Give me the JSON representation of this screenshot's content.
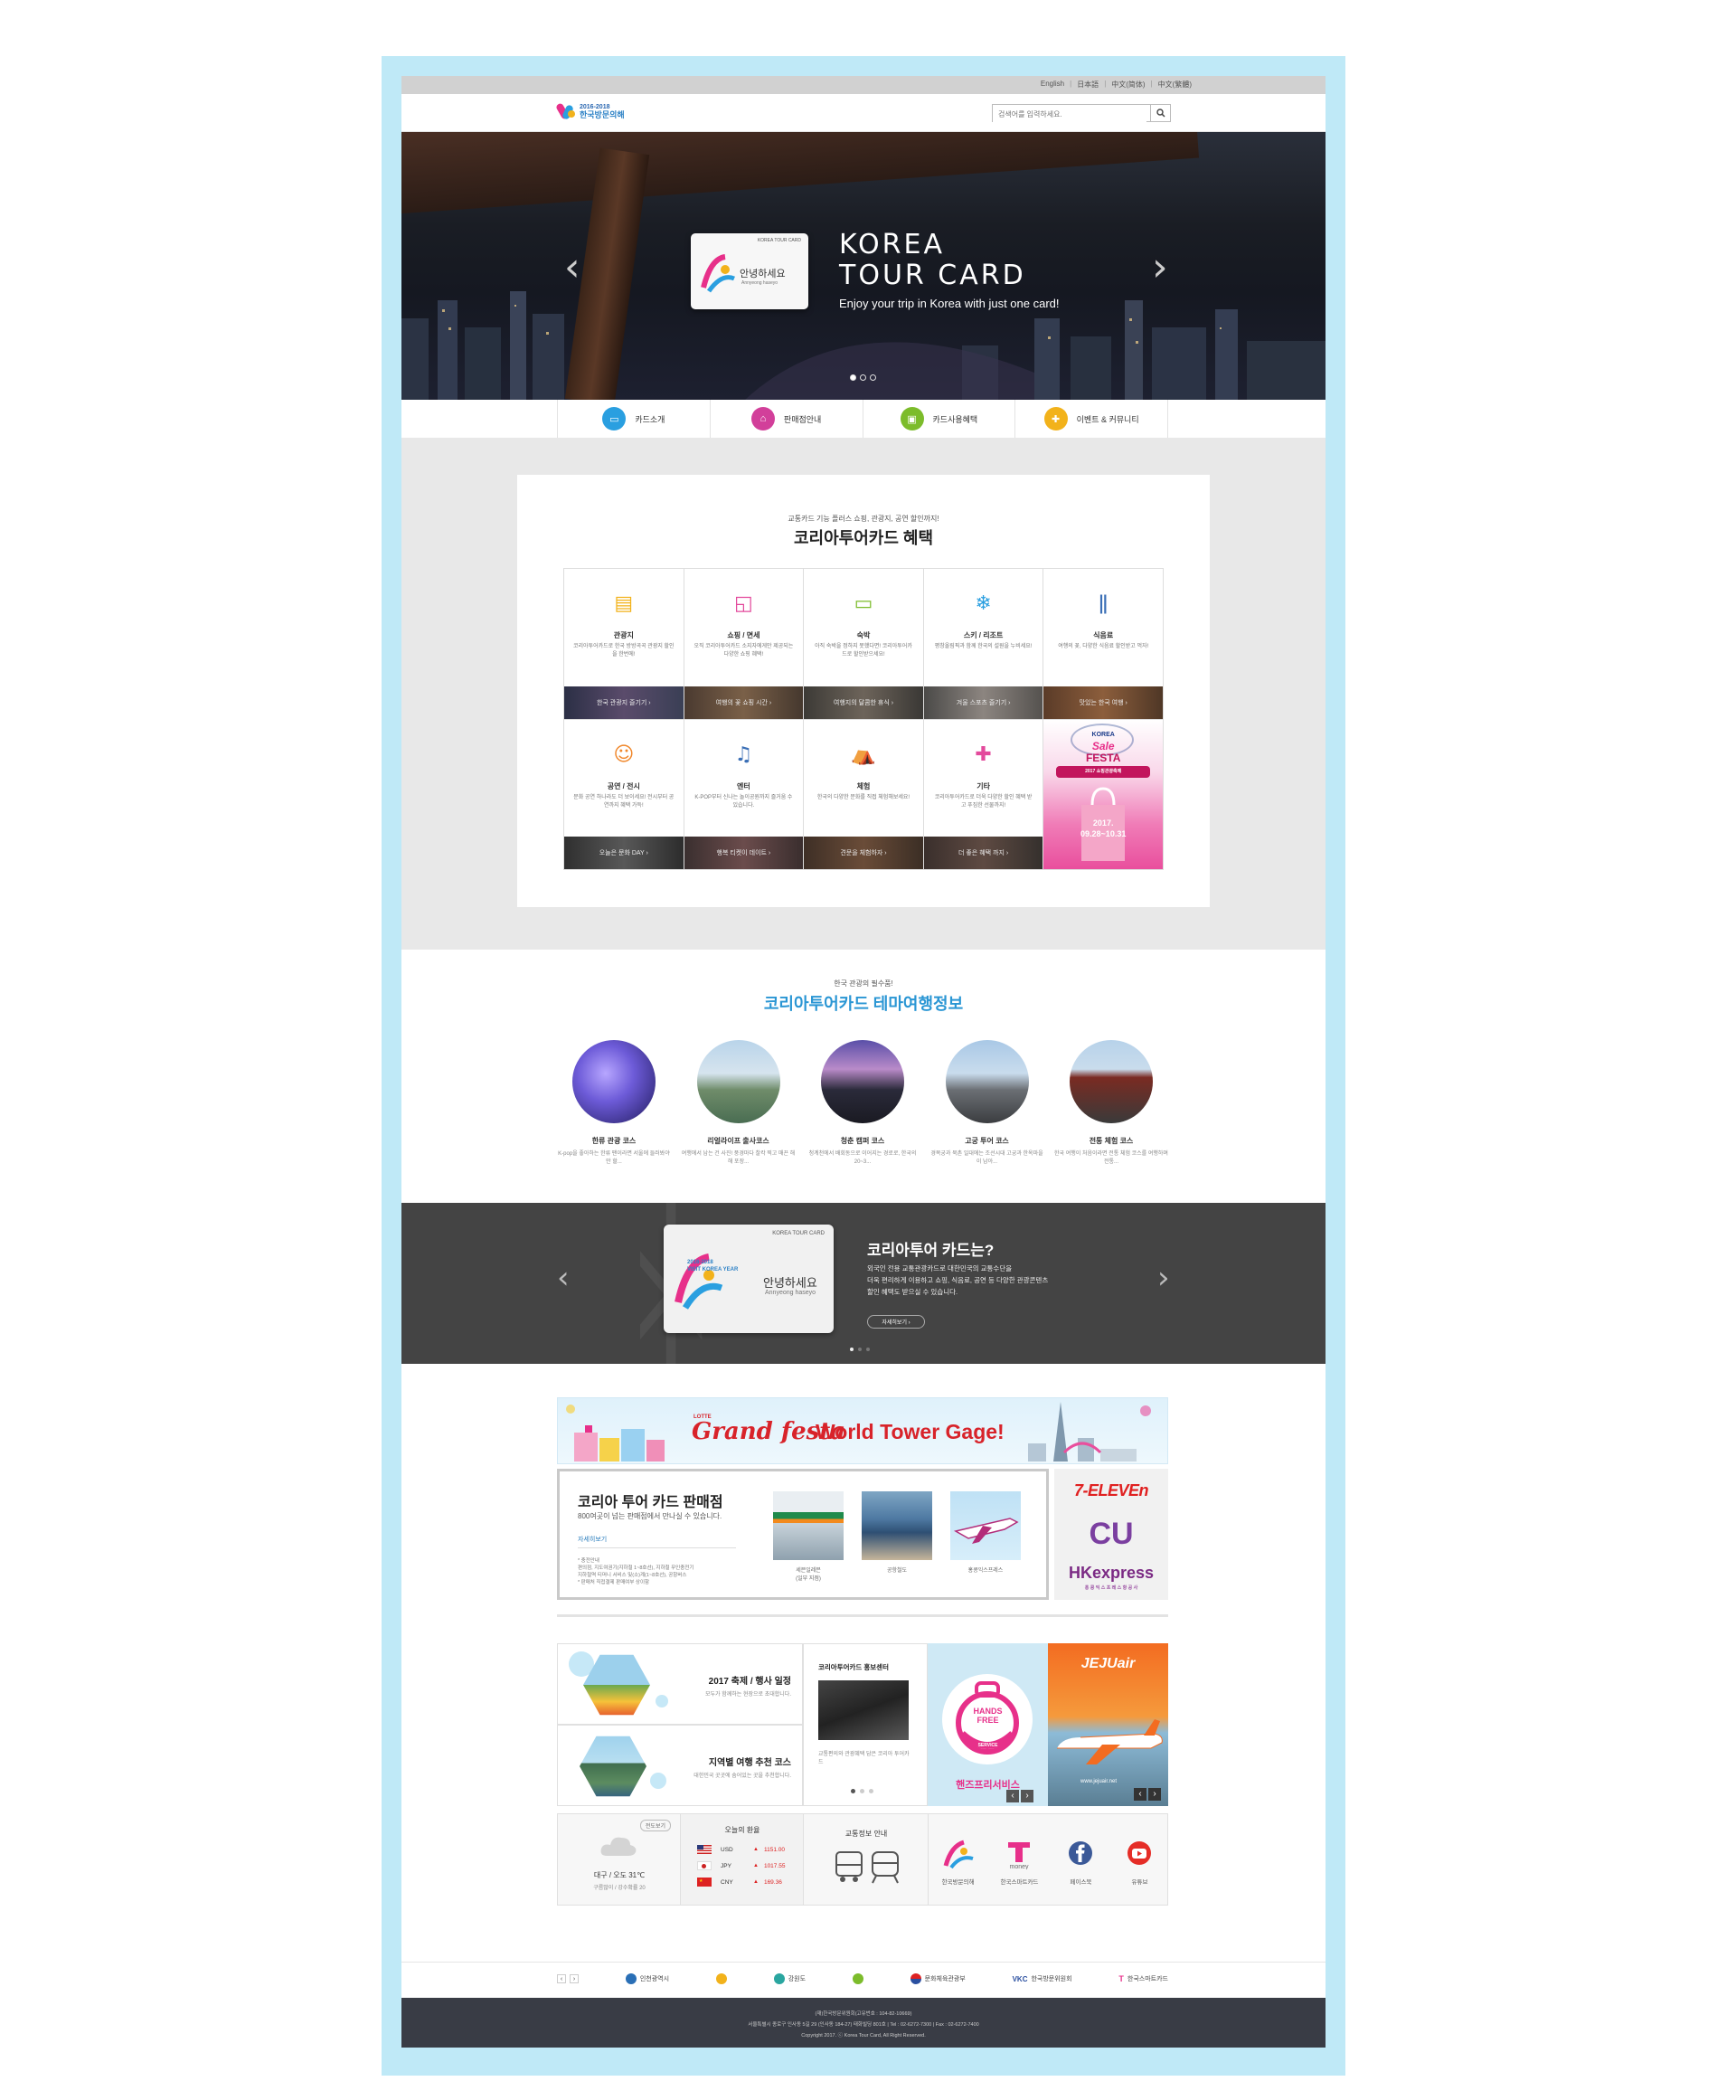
{
  "langbar": {
    "items": [
      "English",
      "日本語",
      "中文(简体)",
      "中文(繁體)"
    ]
  },
  "header": {
    "logo_years": "2016-2018",
    "logo_name": "한국방문의해",
    "search_placeholder": "검색어를 입력하세요."
  },
  "hero": {
    "card_title": "KOREA TOUR CARD",
    "card_greeting": "안녕하세요",
    "card_sub": "Annyeong haseyo",
    "title_line1": "KOREA",
    "title_line2": "TOUR CARD",
    "subtitle": "Enjoy your trip in Korea with just one card!",
    "prev_arrow": "‹",
    "next_arrow": "›",
    "slides": 3,
    "active_slide": 1
  },
  "quick_menu": [
    {
      "label": "카드소개",
      "icon": "card-icon",
      "color": "#2a9fe0",
      "glyph": "▭"
    },
    {
      "label": "판매점안내",
      "icon": "store-icon",
      "color": "#d23f9a",
      "glyph": "⌂"
    },
    {
      "label": "카드사용혜택",
      "icon": "wallet-icon",
      "color": "#7cbc2b",
      "glyph": "▣"
    },
    {
      "label": "이벤트 & 커뮤니티",
      "icon": "gift-icon",
      "color": "#f2b21b",
      "glyph": "✚"
    }
  ],
  "benefits": {
    "pre": "교통카드 기능 플러스 쇼핑, 관광지, 공연 할인까지!",
    "title": "코리아투어카드 혜택",
    "cells": [
      {
        "name": "관광지",
        "desc": "코리아투어카드로 한국 방방곡곡 관광지 할인을 한번에!",
        "strip": "한국 관광지 즐기기 ›",
        "icon": "ticket-icon",
        "glyph": "▤",
        "color": "#f2b21b"
      },
      {
        "name": "쇼핑 / 면세",
        "desc": "오직 코리아투어카드 소지자에게만 제공되는 다양한 쇼핑 혜택!",
        "strip": "여행의 꽃 쇼핑 시간 ›",
        "icon": "shopping-bag-icon",
        "glyph": "◱",
        "color": "#e34a9c"
      },
      {
        "name": "숙박",
        "desc": "아직 숙박을 정하지 못했다면! 코리아투어카드로 할인받으세요!",
        "strip": "여행지의 달콤한 휴식 ›",
        "icon": "bed-icon",
        "glyph": "▭",
        "color": "#7cbc2b"
      },
      {
        "name": "스키 / 리조트",
        "desc": "평창올림픽과 함께 한국의 설원을 누비세요!",
        "strip": "겨울 스포츠 즐기기 ›",
        "icon": "snowflake-icon",
        "glyph": "❄",
        "color": "#2a9fe0"
      },
      {
        "name": "식음료",
        "desc": "여행의 꽃, 다양한 식음료 할인받고 먹자!",
        "strip": "맛있는 한국 여행 ›",
        "icon": "cutlery-icon",
        "glyph": "ǁ",
        "color": "#3b6fb6"
      },
      {
        "name": "공연 / 전시",
        "desc": "문화 공연 하나라도 더 보이세요! 전시부터 공연까지 혜택 가득!",
        "strip": "오늘은 문화 DAY ›",
        "icon": "theater-mask-icon",
        "glyph": "☺",
        "color": "#f0872b"
      },
      {
        "name": "엔터",
        "desc": "K-POP부터 신나는 놀이공원까지 즐거움 수 있습니다.",
        "strip": "행복 티켓이 데이트 ›",
        "icon": "music-note-icon",
        "glyph": "♫",
        "color": "#3b6fb6"
      },
      {
        "name": "체험",
        "desc": "한국의 다양한 문화를 직접 체험해보세요!",
        "strip": "견문을 체험하자 ›",
        "icon": "tent-icon",
        "glyph": "⛺",
        "color": "#7cbc2b"
      },
      {
        "name": "기타",
        "desc": "코리아투어카드로 더욱 다양한 할인 혜택 받고 푸짐한 선물까지!",
        "strip": "더 좋은 혜택 까지 ›",
        "icon": "gift-box-icon",
        "glyph": "✚",
        "color": "#e34a9c"
      }
    ],
    "promo": {
      "title_line1": "KOREA",
      "title_line2": "Sale",
      "title_line3": "FESTA",
      "subtitle": "2017 쇼핑관광축제",
      "date_line1": "2017.",
      "date_line2": "09.28~10.31"
    }
  },
  "theme": {
    "pre": "한국 관광의 필수품!",
    "title": "코리아투어카드 테마여행정보",
    "courses": [
      {
        "name": "한류 관광 코스",
        "desc": "K-pop을 좋아하는 한류 팬이라면 서울에 들러봐야만 할..."
      },
      {
        "name": "리얼라이프 출사코스",
        "desc": "여행에서 남는 건 사진! 풍경마다 찰칵 찍고 매끈 해해 포장..."
      },
      {
        "name": "청춘 캠퍼 코스",
        "desc": "청계천에서 배회동으로 이어지는 경로로, 한국의 20~3..."
      },
      {
        "name": "고궁 투어 코스",
        "desc": "경복궁과 북촌 일대에는 조선시대 고궁과 한옥마을이 남아..."
      },
      {
        "name": "전통 체험 코스",
        "desc": "한국 여행이 처음이라면 전통 체험 코스를 여행하며 전통..."
      }
    ]
  },
  "intro": {
    "card_title": "KOREA TOUR CARD",
    "card_years": "2016-2018",
    "card_visit": "VISIT KOREA YEAR",
    "card_greeting": "안녕하세요",
    "card_sub": "Annyeong haseyo",
    "title": "코리아투어 카드는?",
    "line1": "외국인 전용 교통관광카드로 대한민국의 교통수단을",
    "line2": "더욱 편리하게 이용하고 쇼핑, 식음료, 공연 등 다양한 관광콘텐츠",
    "line3": "할인 혜택도 받으실 수 있습니다.",
    "button": "자세히보기 ›",
    "prev_arrow": "‹",
    "next_arrow": "›",
    "slides": 3,
    "active_slide": 1
  },
  "lotte": {
    "small": "LOTTE",
    "brand": "Grand festa",
    "text": "World Tower Gage!"
  },
  "shop": {
    "title": "코리아 투어 카드 판매점",
    "subtitle": "800여곳이 넘는 판매점에서 만나실 수 있습니다.",
    "more": "자세히보기",
    "notes": [
      "* 충전안내",
      "편의점, 지도여권기(지하철 1~8호선), 지하철 무인충전기",
      "지하철역 티머니 서비스 및(소)계(1~8호선), 공항버스",
      "* 판매처 직접결제 판매여부 상이함"
    ],
    "places": [
      {
        "label_line1": "세븐일레븐",
        "label_line2": "(일부 지점)"
      },
      {
        "label_line1": "공항철도",
        "label_line2": ""
      },
      {
        "label_line1": "홍콩익스프레스",
        "label_line2": ""
      }
    ],
    "partner_logos": [
      "7-ELEVEn",
      "CU",
      "HKexpress"
    ],
    "hk_sub": "홍 콩 익 스 프 레 스 항 공 사"
  },
  "lower": {
    "festival": {
      "title": "2017 축제 / 행사 일정",
      "desc": "모두가 함께하는 현장으로 초대합니다."
    },
    "regional": {
      "title": "지역별 여행 추천 코스",
      "desc": "대한민국 곳곳에 숨어있는 곳을 추천합니다."
    },
    "promo_center": {
      "title": "코리아투어카드 홍보센터",
      "desc": "교통편의와 관광혜택 담은 코리아 투어카드"
    },
    "hands_free": {
      "badge_line1": "HANDS",
      "badge_line2": "FREE",
      "badge_ring": "SERVICE",
      "label": "핸즈프리서비스",
      "prev": "‹",
      "next": "›"
    },
    "jeju": {
      "brand": "JEJUair",
      "url": "www.jejuair.net",
      "prev": "‹",
      "next": "›"
    },
    "weather": {
      "button": "전도보기",
      "city": "대구 / 오도 31℃",
      "detail": "구름많이 / 강수확률 20"
    },
    "exchange": {
      "title": "오늘의 환율",
      "rates": [
        {
          "code": "USD",
          "value": "1151.00"
        },
        {
          "code": "JPY",
          "value": "1017.55"
        },
        {
          "code": "CNY",
          "value": "169.36"
        }
      ]
    },
    "transport": {
      "title": "교통정보 안내"
    },
    "links": [
      {
        "label": "한국방문의해",
        "icon": "visit-korea-logo-icon"
      },
      {
        "label": "한국스마트카드",
        "icon": "tmoney-icon"
      },
      {
        "label": "페이스북",
        "icon": "facebook-icon"
      },
      {
        "label": "유튜브",
        "icon": "youtube-icon"
      }
    ]
  },
  "partners": [
    "인천광역시",
    "강원도",
    "문화체육관광부",
    "한국방문위원회",
    "한국스마트카드"
  ],
  "footer": {
    "line1": "(재)한국방문위원회(고유번호 : 104-82-10669)",
    "line2": "서울특별시 종로구 인사동 5길 29 (인사동 184-27) 태화빌딩 801호  |  Tel : 02-6272-7300  |  Fax : 02-6272-7400",
    "line3": "Copyright 2017. ⓒ Korea Tour Card, All Right Reserved."
  }
}
